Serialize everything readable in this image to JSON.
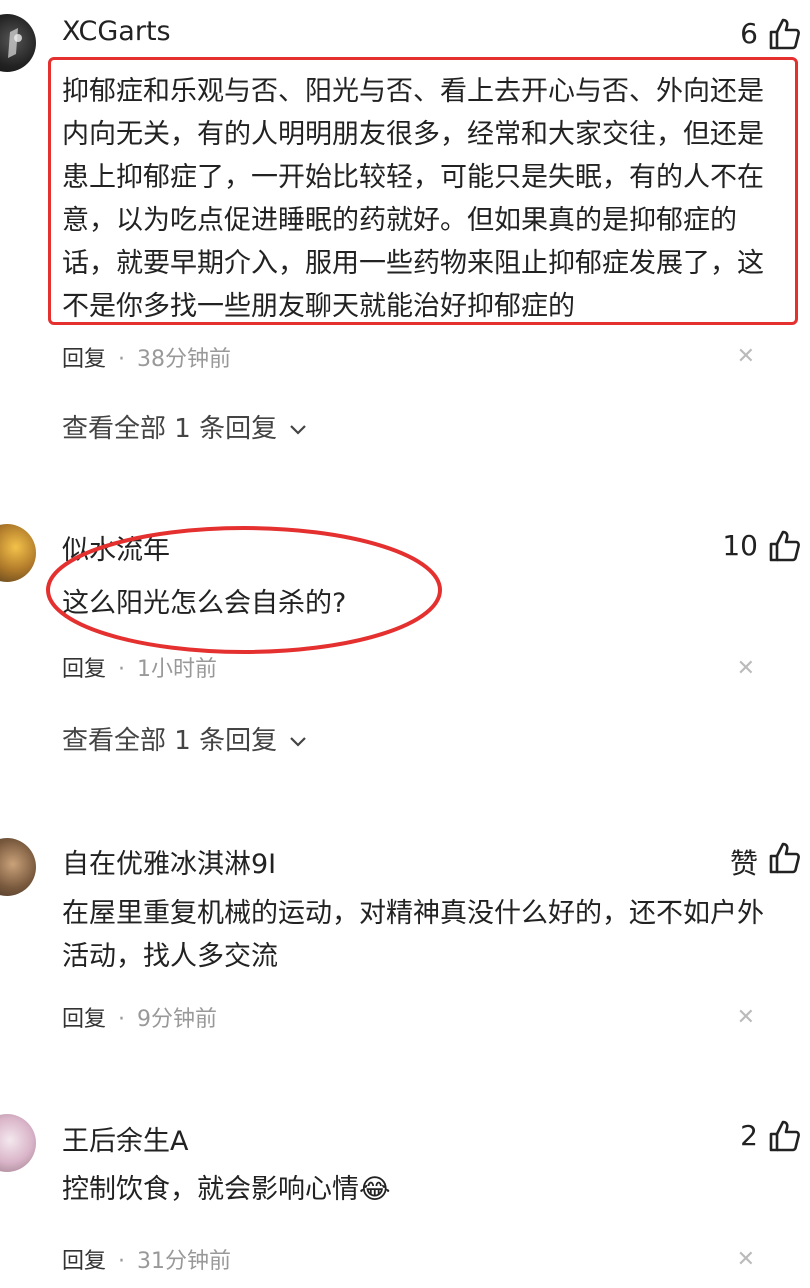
{
  "comments": [
    {
      "username": "XCGarts",
      "likes": "6",
      "text": "抑郁症和乐观与否、阳光与否、看上去开心与否、外向还是内向无关，有的人明明朋友很多，经常和大家交往，但还是患上抑郁症了，一开始比较轻，可能只是失眠，有的人不在意，以为吃点促进睡眠的药就好。但如果真的是抑郁症的话，就要早期介入，服用一些药物来阻止抑郁症发展了，这不是你多找一些朋友聊天就能治好抑郁症的",
      "reply_label": "回复",
      "time": "38分钟前",
      "view_all": "查看全部 1 条回复"
    },
    {
      "username": "似水流年",
      "likes": "10",
      "text": "这么阳光怎么会自杀的?",
      "reply_label": "回复",
      "time": "1小时前",
      "view_all": "查看全部 1 条回复"
    },
    {
      "username": "自在优雅冰淇淋9I",
      "likes": "赞",
      "text": "在屋里重复机械的运动，对精神真没什么好的，还不如户外活动，找人多交流",
      "reply_label": "回复",
      "time": "9分钟前"
    },
    {
      "username": "王后余生A",
      "likes": "2",
      "text": "控制饮食，就会影响心情",
      "emoji": "😂",
      "reply_label": "回复",
      "time": "31分钟前"
    }
  ],
  "colors": {
    "highlight": "#e53030",
    "meta_text": "#999999",
    "body_text": "#222222"
  },
  "icons": {
    "like": "thumbs-up-icon",
    "close": "close-icon",
    "chevron": "chevron-down-icon"
  }
}
